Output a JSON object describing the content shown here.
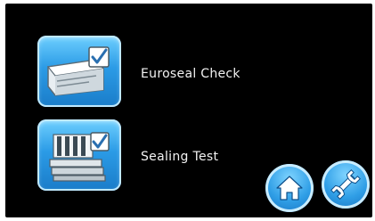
{
  "menu": {
    "items": [
      {
        "label": "Euroseal Check",
        "icon": "euroseal-check-icon"
      },
      {
        "label": "Sealing Test",
        "icon": "sealing-test-icon"
      }
    ]
  },
  "footer": {
    "home_icon": "home-icon",
    "settings_icon": "wrench-icon"
  },
  "colors": {
    "background": "#000000",
    "accent": "#2b9be6",
    "label_text": "#f2f2f2"
  }
}
